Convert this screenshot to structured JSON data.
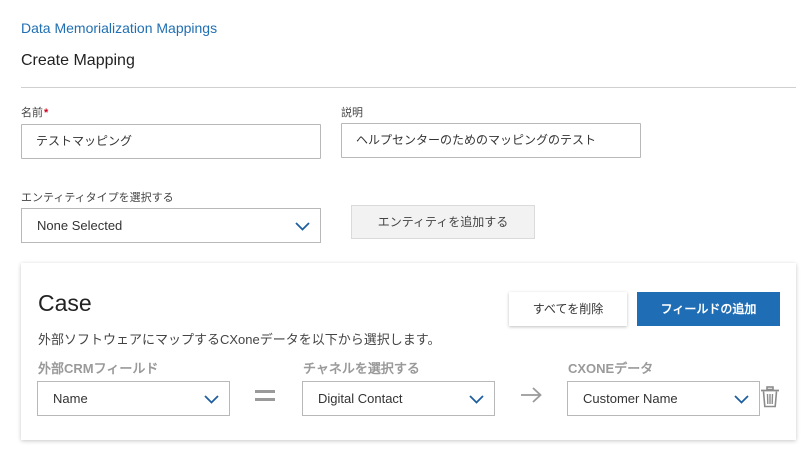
{
  "breadcrumb": "Data Memorialization Mappings",
  "page_title": "Create Mapping",
  "form": {
    "name_label": "名前",
    "name_required_mark": "*",
    "name_value": "テストマッピング",
    "description_label": "説明",
    "description_value": "ヘルプセンターのためのマッピングのテスト",
    "entity_type_label": "エンティティタイプを選択する",
    "entity_type_value": "None Selected",
    "add_entity_button": "エンティティを追加する"
  },
  "card": {
    "title": "Case",
    "description": "外部ソフトウェアにマップするCXoneデータを以下から選択します。",
    "delete_all_button": "すべてを削除",
    "add_field_button": "フィールドの追加",
    "columns": {
      "external_crm_label": "外部CRMフィールド",
      "channel_label": "チャネルを選択する",
      "cxone_label": "CXONEデータ"
    },
    "mapping_row": {
      "external_crm_value": "Name",
      "channel_value": "Digital Contact",
      "cxone_value": "Customer Name"
    }
  },
  "colors": {
    "link": "#1f6fb2",
    "primary_button": "#1f6db5",
    "required": "#d0021b",
    "icon": "#1f5fa0"
  }
}
